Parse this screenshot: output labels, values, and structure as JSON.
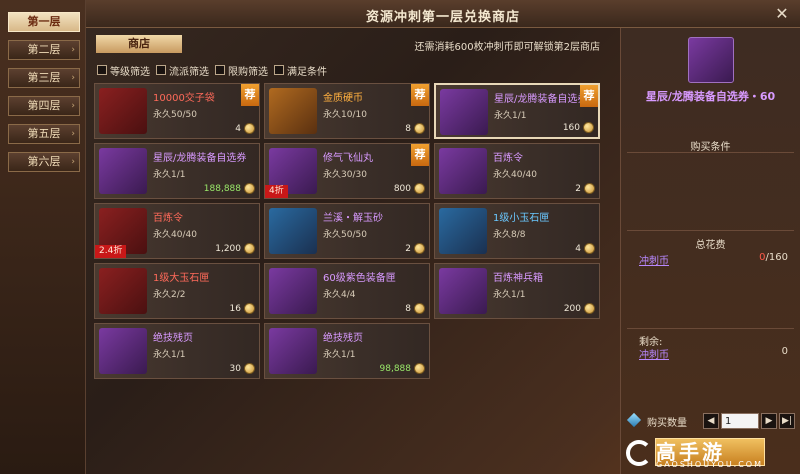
{
  "window": {
    "title": "资源冲刺第一层兑换商店"
  },
  "floors": [
    {
      "label": "第一层",
      "active": true
    },
    {
      "label": "第二层"
    },
    {
      "label": "第三层"
    },
    {
      "label": "第四层"
    },
    {
      "label": "第五层"
    },
    {
      "label": "第六层"
    }
  ],
  "shop_tab": "商店",
  "notice": "还需消耗600枚冲刺币即可解锁第2层商店",
  "filters": [
    "等级筛选",
    "流派筛选",
    "限购筛选",
    "满足条件"
  ],
  "items": [
    {
      "name": "10000交子袋",
      "stock": "永久50/50",
      "price": "4",
      "recommended": true,
      "color": "red",
      "bg": "red"
    },
    {
      "name": "金质硬币",
      "stock": "永久10/10",
      "price": "8",
      "recommended": true,
      "color": "orange",
      "bg": "orange"
    },
    {
      "name": "星辰/龙腾装备自选券",
      "stock": "永久1/1",
      "price": "160",
      "recommended": true,
      "color": "purple",
      "bg": "purple",
      "selected": true
    },
    {
      "name": "星辰/龙腾装备自选券",
      "stock": "永久1/1",
      "price": "188,888",
      "price_green": true,
      "color": "purple",
      "bg": "purple"
    },
    {
      "name": "修气飞仙丸",
      "stock": "永久30/30",
      "price": "800",
      "recommended": true,
      "discount": "4折",
      "color": "purple",
      "bg": "purple"
    },
    {
      "name": "百炼令",
      "stock": "永久40/40",
      "price": "2",
      "color": "purple",
      "bg": "purple"
    },
    {
      "name": "百炼令",
      "stock": "永久40/40",
      "price": "1,200",
      "discount": "2.4折",
      "color": "red",
      "bg": "red"
    },
    {
      "name": "兰溪・解玉砂",
      "stock": "永久50/50",
      "price": "2",
      "color": "purple",
      "bg": "blue"
    },
    {
      "name": "1级小玉石匣",
      "stock": "永久8/8",
      "price": "4",
      "color": "blue",
      "bg": "blue"
    },
    {
      "name": "1级大玉石匣",
      "stock": "永久2/2",
      "price": "16",
      "color": "red",
      "bg": "red"
    },
    {
      "name": "60级紫色装备匣",
      "stock": "永久4/4",
      "price": "8",
      "color": "purple",
      "bg": "purple"
    },
    {
      "name": "百炼神兵箱",
      "stock": "永久1/1",
      "price": "200",
      "color": "purple",
      "bg": "purple"
    },
    {
      "name": "绝技残页",
      "stock": "永久1/1",
      "price": "30",
      "color": "purple",
      "bg": "purple"
    },
    {
      "name": "绝技残页",
      "stock": "永久1/1",
      "price": "98,888",
      "price_green": true,
      "color": "purple",
      "bg": "purple"
    }
  ],
  "rec_label": "荐",
  "detail": {
    "name": "星辰/龙腾装备自选券・60",
    "purchase_conditions": "购买条件",
    "total_cost": "总花费",
    "currency_link": "冲刺币",
    "cost_have": "0",
    "cost_need": "/160",
    "remaining_label": "剩余:",
    "remaining_currency": "冲刺币",
    "remaining_value": "0",
    "qty_label": "购买数量",
    "qty_value": "1"
  },
  "watermark": {
    "main": "高手游",
    "sub": "GAOSHOUYOU.COM"
  },
  "colors": {
    "accent": "#f0d8a8",
    "purple_text": "#d89aff",
    "red_text": "#ff6a5a",
    "discount_bg": "#c81818",
    "rec_bg": "#f0a030"
  }
}
